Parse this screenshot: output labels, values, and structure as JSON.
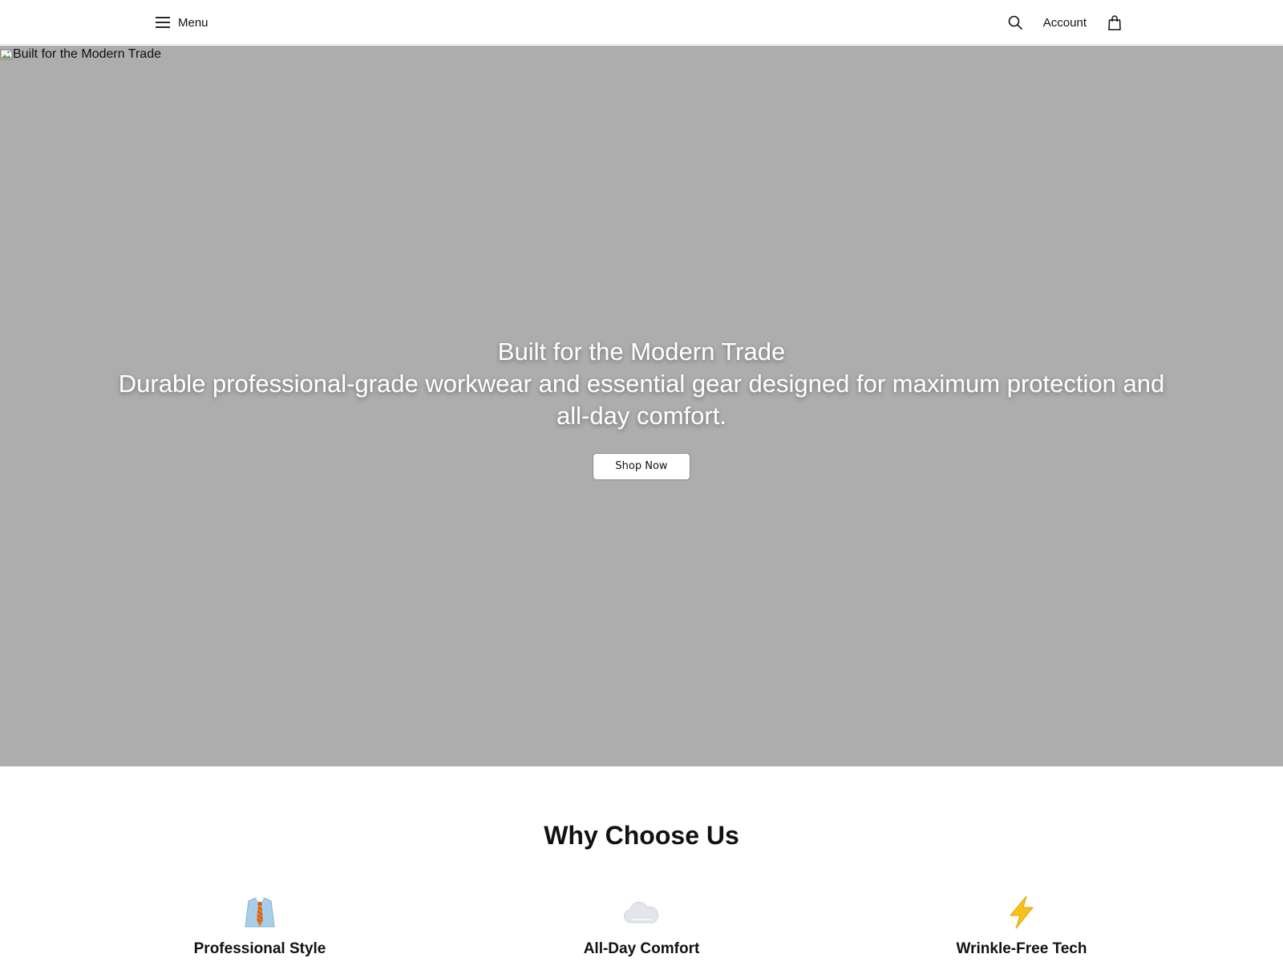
{
  "header": {
    "menu_label": "Menu",
    "account_label": "Account",
    "icons": {
      "menu": "hamburger-icon",
      "search": "search-icon",
      "bag": "shopping-bag-icon"
    }
  },
  "hero": {
    "image_alt": "Built for the Modern Trade",
    "title": "Built for the Modern Trade",
    "subtitle": "Durable professional-grade workwear and essential gear designed for maximum protection and all-day comfort.",
    "cta_label": "Shop Now",
    "background_color": "#adadad"
  },
  "why": {
    "title": "Why Choose Us",
    "features": [
      {
        "icon": "shirt-tie-icon",
        "title": "Professional Style"
      },
      {
        "icon": "cloud-icon",
        "title": "All-Day Comfort"
      },
      {
        "icon": "lightning-icon",
        "title": "Wrinkle-Free Tech"
      }
    ]
  }
}
